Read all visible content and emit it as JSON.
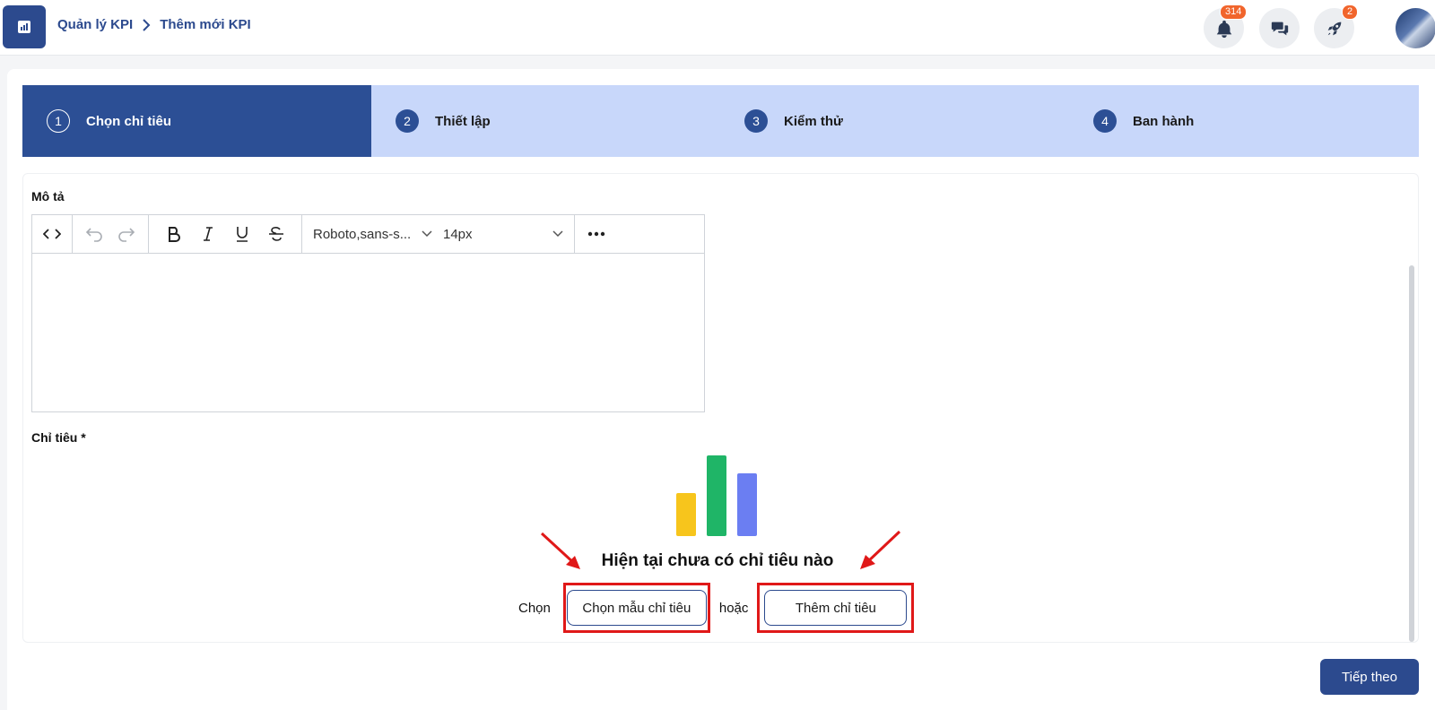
{
  "header": {
    "breadcrumb": [
      "Quản lý KPI",
      "Thêm mới KPI"
    ],
    "notifications_count": "314",
    "rocket_count": "2"
  },
  "stepper": [
    {
      "num": "1",
      "label": "Chọn chỉ tiêu",
      "active": true
    },
    {
      "num": "2",
      "label": "Thiết lập",
      "active": false
    },
    {
      "num": "3",
      "label": "Kiểm thử",
      "active": false
    },
    {
      "num": "4",
      "label": "Ban hành",
      "active": false
    }
  ],
  "form": {
    "description_label": "Mô tả",
    "font_family": "Roboto,sans-s...",
    "font_size": "14px",
    "criteria_label": "Chỉ tiêu *"
  },
  "empty_state": {
    "title": "Hiện tại chưa có chỉ tiêu nào",
    "prefix": "Chọn",
    "template_button": "Chọn mẫu chỉ tiêu",
    "or": "hoặc",
    "add_button": "Thêm chỉ tiêu"
  },
  "footer": {
    "next_button": "Tiếp theo"
  },
  "colors": {
    "primary": "#2c4a8e",
    "stepper_bg": "#c8d7fa",
    "badge": "#f1652c",
    "highlight": "#e01818",
    "bar_yellow": "#f7c51c",
    "bar_green": "#1fb567",
    "bar_blue": "#6b7ef2"
  }
}
